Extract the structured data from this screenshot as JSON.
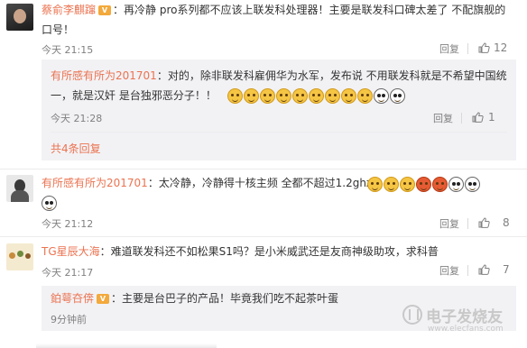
{
  "comments": [
    {
      "user": "蔡俞李麒蹿",
      "text": "：再冷静 pro系列都不应该上联发科处理器！主要是联发科口碑太差了 不配旗舰的口号！",
      "time": "今天 21:15",
      "reply": "回复",
      "likes": "12"
    },
    {
      "user": "有所感有所为201701",
      "text": "：对的，除非联发科雇佣华为水军，发布说 不用联发科就是不希望中国统一，就是汉奸 是台独邪恶分子！！",
      "time": "今天 21:28",
      "reply": "回复",
      "likes": "1"
    },
    {
      "more_replies": "共4条回复"
    },
    {
      "user": "有所感有所为201701",
      "text": "：太冷静，冷静得十核主频 全都不超过1.2ghz",
      "time": "今天 21:12",
      "reply": "回复",
      "likes": "8"
    },
    {
      "user": "TG星辰大海",
      "text": "：难道联发科还不如松果S1吗？是小米威武还是友商神级助攻，求科普",
      "time": "今天 21:17",
      "reply": "回复",
      "likes": "7"
    },
    {
      "user": "鉑萼夻倴",
      "text": "：主要是台巴子的产品！毕竟我们吃不起茶叶蛋",
      "time": "9分钟前"
    }
  ],
  "watermark": "电子发烧友",
  "watermark_url": "www.elecfans.com",
  "vip_badge": "V",
  "colors": {
    "username": "#eb7350",
    "reply_bg": "#f2f2f5"
  }
}
